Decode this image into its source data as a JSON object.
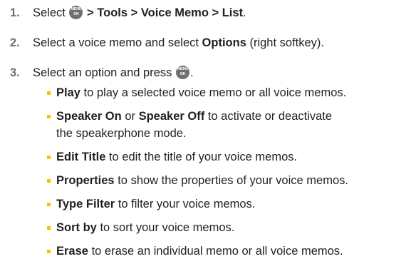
{
  "steps": [
    {
      "num": "1.",
      "pre": "Select",
      "post": "> Tools > Voice Memo > List",
      "post_end": "."
    },
    {
      "num": "2.",
      "pre": "Select a voice memo and select",
      "bold": "Options",
      "post": "(right softkey)."
    },
    {
      "num": "3.",
      "pre": "Select an option and press",
      "post": "."
    }
  ],
  "menu_key": {
    "top": "MENU",
    "bottom": "OK",
    "color": "#6d6e71",
    "icon": "menu-ok-key-icon"
  },
  "bullet_color": "#f5c400",
  "options": [
    {
      "term": "Play",
      "desc": "to play a selected voice memo or all voice memos."
    },
    {
      "term": "Speaker On",
      "mid": "or",
      "term2": "Speaker Off",
      "desc": "to activate or deactivate",
      "desc2": "the speakerphone mode."
    },
    {
      "term": "Edit Title",
      "desc": "to edit the title of your voice memos."
    },
    {
      "term": "Properties",
      "desc": "to show the properties of your voice memos."
    },
    {
      "term": "Type Filter",
      "desc": "to filter your voice memos."
    },
    {
      "term": "Sort by",
      "desc": "to sort your voice memos."
    },
    {
      "term": "Erase",
      "desc": "to erase an individual memo or all voice memos."
    }
  ]
}
